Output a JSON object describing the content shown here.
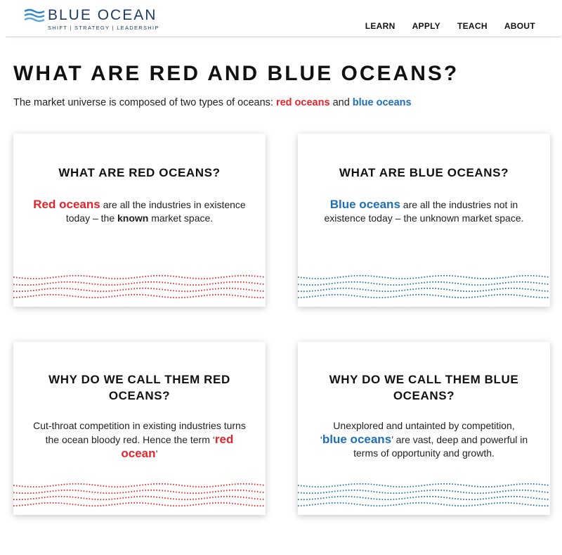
{
  "header": {
    "logo_word": "BLUE OCEAN",
    "logo_tagline": "SHIFT | STRATEGY | LEADERSHIP",
    "nav": [
      {
        "label": "LEARN"
      },
      {
        "label": "APPLY"
      },
      {
        "label": "TEACH"
      },
      {
        "label": "ABOUT"
      }
    ]
  },
  "main": {
    "title": "WHAT ARE RED AND BLUE OCEANS?",
    "intro": {
      "prefix": "The market universe is composed of two types of oceans: ",
      "red": "red oceans",
      "middle": " and ",
      "blue": "blue oceans"
    }
  },
  "colors": {
    "red": "#e3242b",
    "blue": "#1f6fb5",
    "logo_navy": "#1f3a5f"
  },
  "cards": {
    "red_what": {
      "title": "WHAT ARE RED OCEANS?",
      "lead": "Red oceans",
      "text1": " are all the industries in existence today – the ",
      "bold": "known",
      "text2": " market space."
    },
    "blue_what": {
      "title": "WHAT ARE BLUE OCEANS?",
      "lead": "Blue oceans",
      "text1": " are all the industries not in existence today – the unknown market space."
    },
    "red_why": {
      "title": "WHY DO WE CALL THEM RED OCEANS?",
      "text1": "Cut-throat competition in existing industries turns the ocean bloody red. Hence the term ",
      "quote_open": "‘",
      "highlight": "red ocean",
      "quote_close": "’"
    },
    "blue_why": {
      "title": "WHY DO WE CALL THEM BLUE OCEANS?",
      "text1": "Unexplored and untainted by competition,",
      "quote_open": "‘",
      "highlight": "blue oceans",
      "quote_close": "’",
      "text2": " are vast, deep and powerful in terms of opportunity and growth."
    }
  }
}
